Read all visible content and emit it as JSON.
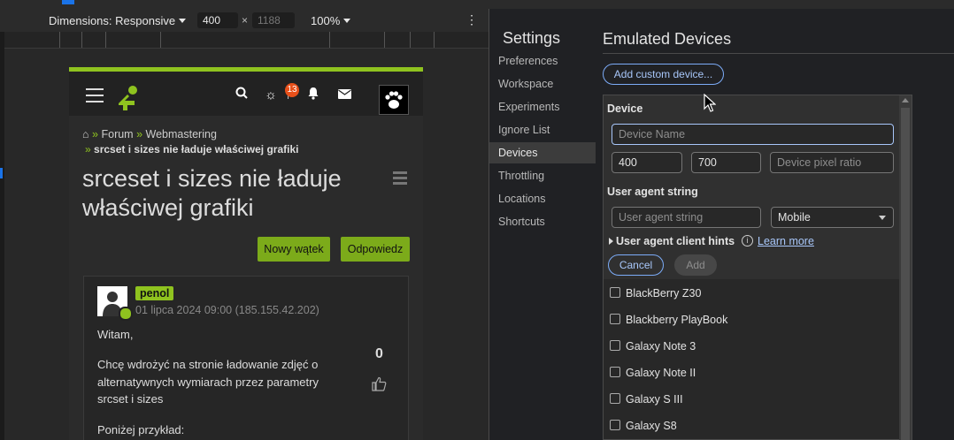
{
  "toolbar": {
    "dimensions_label": "Dimensions: Responsive",
    "width_value": "400",
    "times_sign": "×",
    "height_placeholder": "1188",
    "zoom_label": "100%",
    "more_glyph": "⋮"
  },
  "emulated_page": {
    "notification_count": "13",
    "breadcrumb": {
      "home_sep": "»",
      "forum": "Forum",
      "sep": "»",
      "category": "Webmastering",
      "current_sep": "»",
      "current": "srcset i sizes nie ładuje właściwej grafiki"
    },
    "title": "srceset i sizes nie ładuje właściwej grafiki",
    "new_thread_button": "Nowy wątek",
    "reply_button": "Odpowiedz",
    "post": {
      "author": "penol",
      "date": "01 lipca 2024 09:00 (185.155.42.202)",
      "greeting": "Witam,",
      "body": "Chcę wdrożyć na stronie ładowanie zdjęć o alternatywnych wymiarach przez parametry srcset i sizes",
      "example": "Poniżej przykład:",
      "votes": "0"
    }
  },
  "settings": {
    "title": "Settings",
    "nav": [
      {
        "label": "Preferences",
        "active": false
      },
      {
        "label": "Workspace",
        "active": false
      },
      {
        "label": "Experiments",
        "active": false
      },
      {
        "label": "Ignore List",
        "active": false
      },
      {
        "label": "Devices",
        "active": true
      },
      {
        "label": "Throttling",
        "active": false
      },
      {
        "label": "Locations",
        "active": false
      },
      {
        "label": "Shortcuts",
        "active": false
      }
    ]
  },
  "devices": {
    "title": "Emulated Devices",
    "add_custom_label": "Add custom device...",
    "form": {
      "device_label": "Device",
      "name_placeholder": "Device Name",
      "width_value": "400",
      "height_value": "700",
      "dpr_placeholder": "Device pixel ratio",
      "ua_label": "User agent string",
      "ua_placeholder": "User agent string",
      "ua_type": "Mobile",
      "hints_label": "User agent client hints",
      "info_glyph": "i",
      "learn_more": "Learn more",
      "cancel_label": "Cancel",
      "add_label": "Add"
    },
    "list": [
      "BlackBerry Z30",
      "Blackberry PlayBook",
      "Galaxy Note 3",
      "Galaxy Note II",
      "Galaxy S III",
      "Galaxy S8"
    ]
  },
  "colors": {
    "accent_green": "#8fc31f",
    "link_blue": "#a8c7fa",
    "badge_orange": "#e8501a"
  }
}
